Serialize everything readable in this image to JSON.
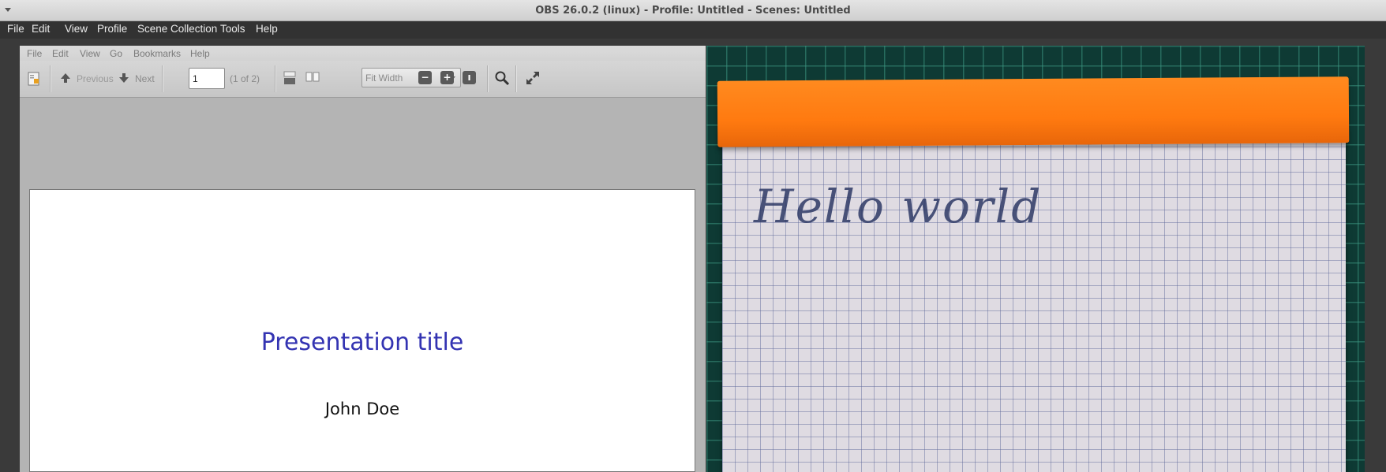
{
  "window": {
    "title": "OBS 26.0.2 (linux) - Profile: Untitled - Scenes: Untitled"
  },
  "menubar": {
    "items": [
      "File",
      "Edit",
      "View",
      "Profile",
      "Scene Collection",
      "Tools",
      "Help"
    ]
  },
  "pdf_viewer": {
    "menu": [
      "File",
      "Edit",
      "View",
      "Go",
      "Bookmarks",
      "Help"
    ],
    "toolbar": {
      "previous_label": "Previous",
      "next_label": "Next",
      "page_value": "1",
      "page_count": "(1 of 2)",
      "zoom_value": "Fit Width"
    },
    "page": {
      "title": "Presentation title",
      "author": "John Doe"
    }
  },
  "camera": {
    "handwriting": "Hello world"
  },
  "colors": {
    "title_blue": "#3333b2",
    "notepad_orange": "#ff7a10",
    "obs_dark": "#323232"
  }
}
